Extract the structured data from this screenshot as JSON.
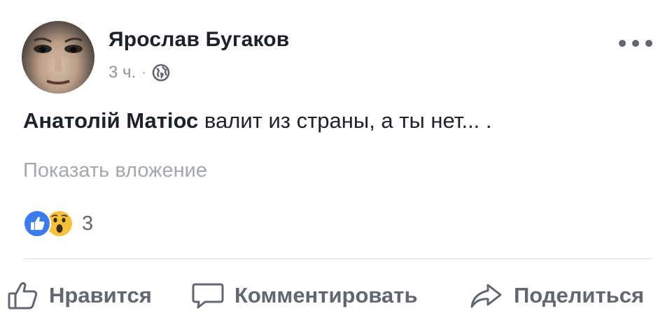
{
  "post": {
    "author": "Ярослав Бугаков",
    "time": "3 ч.",
    "separator": "·",
    "privacy_icon": "globe-icon",
    "more_icon": "more-options-icon",
    "text": {
      "mention": "Анатолій Матіос",
      "body": " валит из страны, а ты нет... ."
    },
    "attachment_link": "Показать вложение",
    "reactions": {
      "types": [
        "like",
        "wow"
      ],
      "count": "3"
    }
  },
  "actions": {
    "like": "Нравится",
    "comment": "Комментировать",
    "share": "Поделиться"
  },
  "colors": {
    "secondary_text": "#90949c",
    "action_text": "#606770",
    "like_blue": "#3b7af0",
    "wow_yellow": "#f7c23b",
    "divider": "#dadde1"
  }
}
